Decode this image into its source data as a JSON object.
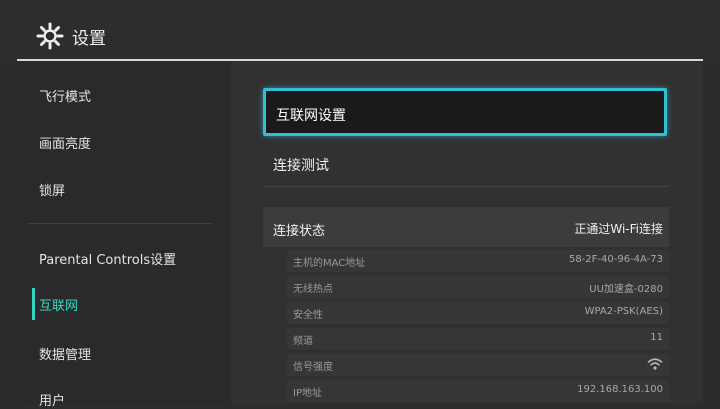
{
  "header": {
    "title": "设置",
    "icon": "gear-icon"
  },
  "sidebar": {
    "items": [
      {
        "label": "飞行模式"
      },
      {
        "label": "画面亮度"
      },
      {
        "label": "锁屏"
      },
      {
        "label": "Parental Controls设置"
      },
      {
        "label": "互联网",
        "active": true
      },
      {
        "label": "数据管理"
      },
      {
        "label": "用户"
      }
    ]
  },
  "main": {
    "menu": [
      {
        "label": "互联网设置",
        "selected": true
      },
      {
        "label": "连接测试"
      }
    ],
    "status": {
      "label": "连接状态",
      "value": "正通过Wi-Fi连接",
      "rows": [
        {
          "key": "主机的MAC地址",
          "value": "58-2F-40-96-4A-73"
        },
        {
          "key": "无线热点",
          "value": "UU加速盒-0280"
        },
        {
          "key": "安全性",
          "value": "WPA2-PSK(AES)"
        },
        {
          "key": "频道",
          "value": "11"
        },
        {
          "key": "信号强度",
          "value": "",
          "icon": "wifi-signal-icon"
        },
        {
          "key": "IP地址",
          "value": "192.168.163.100"
        }
      ]
    }
  },
  "colors": {
    "accent": "#35d3c4",
    "focus": "#2fc0d6",
    "background": "#2c2c2c"
  }
}
